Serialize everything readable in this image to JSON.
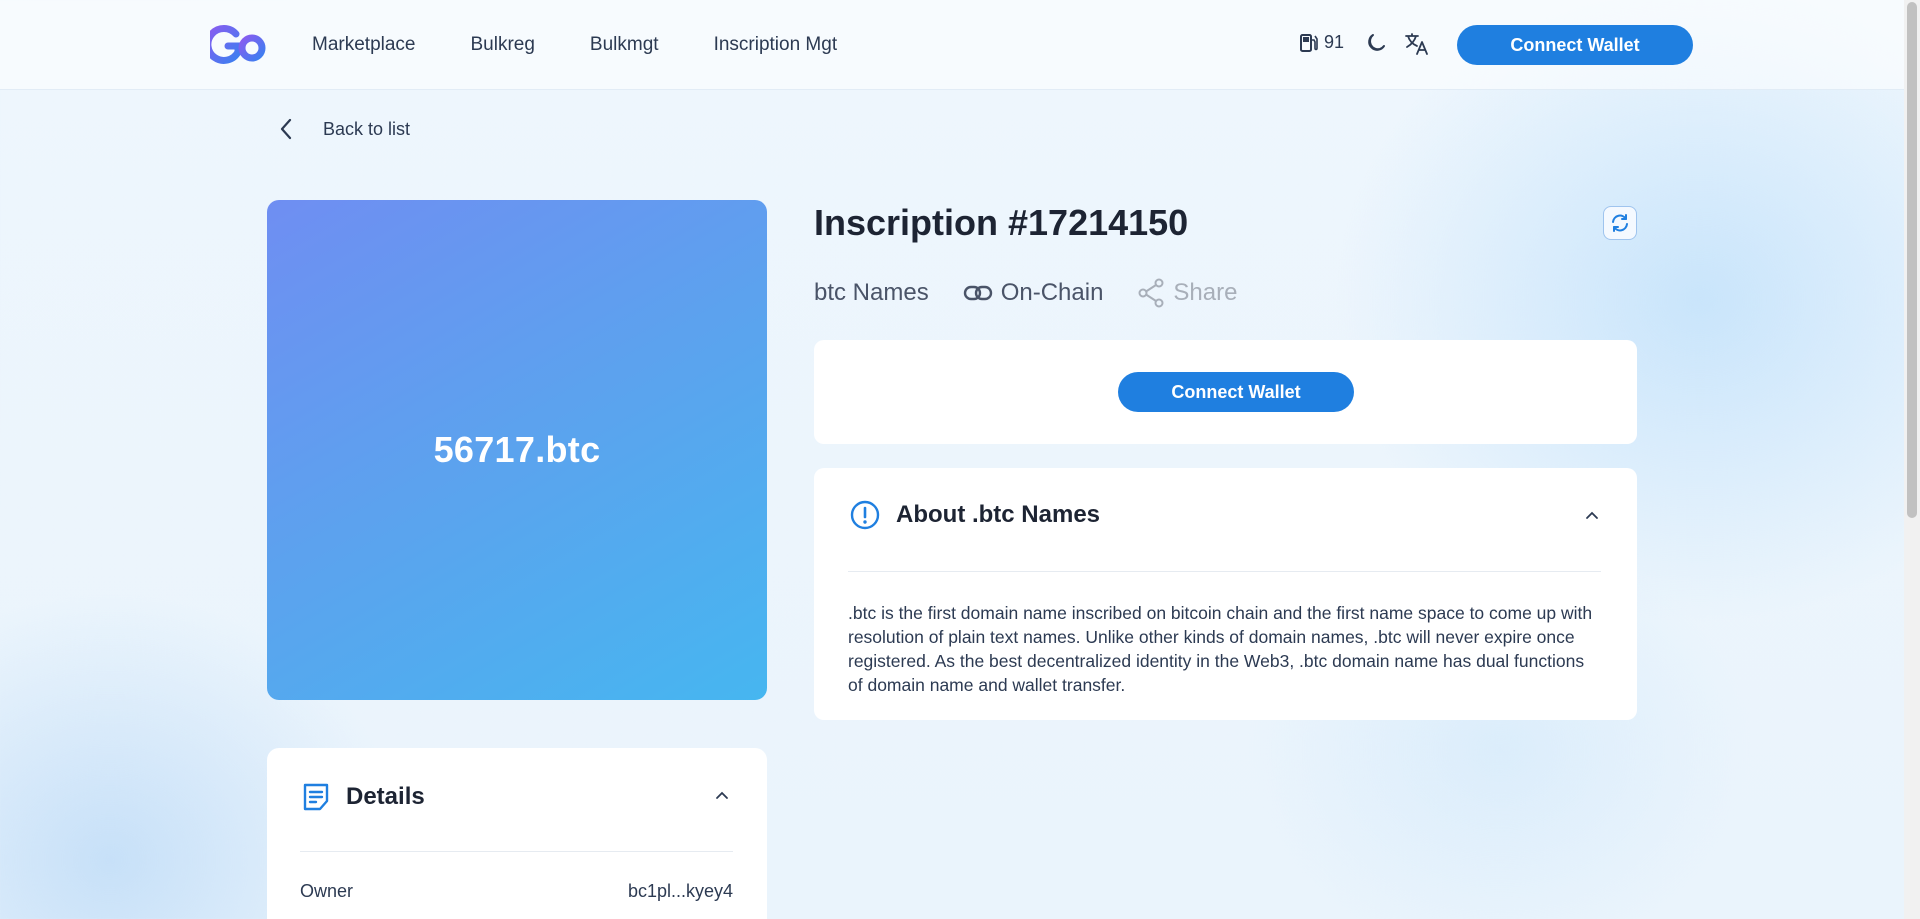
{
  "header": {
    "nav": [
      "Marketplace",
      "Bulkreg",
      "Bulkmgt",
      "Inscription Mgt"
    ],
    "gas_value": "91",
    "connect_label": "Connect Wallet",
    "icons": [
      "logo",
      "gas-pump-icon",
      "moon-icon",
      "translate-icon"
    ]
  },
  "back_label": "Back to list",
  "inscription": {
    "name": "56717.btc",
    "title": "Inscription #17214150",
    "collection": "btc Names",
    "chain_label": "On-Chain",
    "share_label": "Share"
  },
  "wallet_panel": {
    "connect_label": "Connect Wallet"
  },
  "about": {
    "title": "About .btc Names",
    "text": ".btc is the first domain name inscribed on bitcoin chain and the first name space to come up with resolution of plain text names. Unlike other kinds of domain names, .btc will never expire once registered. As the best decentralized identity in the Web3, .btc domain name has dual functions of domain name and wallet transfer."
  },
  "details": {
    "title": "Details",
    "rows": [
      {
        "label": "Owner",
        "value": "bc1pl...kyey4"
      }
    ]
  },
  "colors": {
    "accent": "#1f7fe0",
    "card_gradient_start": "#6f8ef2",
    "card_gradient_end": "#46b6f0"
  }
}
